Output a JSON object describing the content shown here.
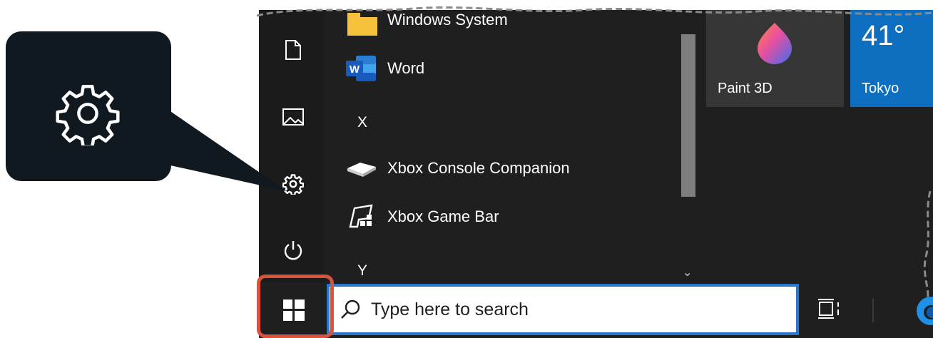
{
  "start_menu": {
    "rail": [
      "document-icon",
      "pictures-icon",
      "settings-icon",
      "power-icon"
    ],
    "apps": [
      {
        "label": "Windows System",
        "icon": "folder-icon"
      },
      {
        "label": "Word",
        "icon": "word-icon"
      },
      {
        "label": "Xbox Console Companion",
        "icon": "xbox-console-icon"
      },
      {
        "label": "Xbox Game Bar",
        "icon": "xbox-game-bar-icon"
      }
    ],
    "letters": [
      "X",
      "Y"
    ],
    "tiles": {
      "paint": {
        "label": "Paint 3D",
        "icon": "paint3d-icon"
      },
      "weather": {
        "label": "Tokyo",
        "temperature": "41°"
      }
    }
  },
  "taskbar": {
    "search_placeholder": "Type here to search"
  },
  "callout": {
    "icon": "gear-icon"
  },
  "colors": {
    "highlight": "#d9533c",
    "search_border": "#2b77c9",
    "weather_tile": "#0e6ec0",
    "menu_bg": "#1f1f1f"
  }
}
